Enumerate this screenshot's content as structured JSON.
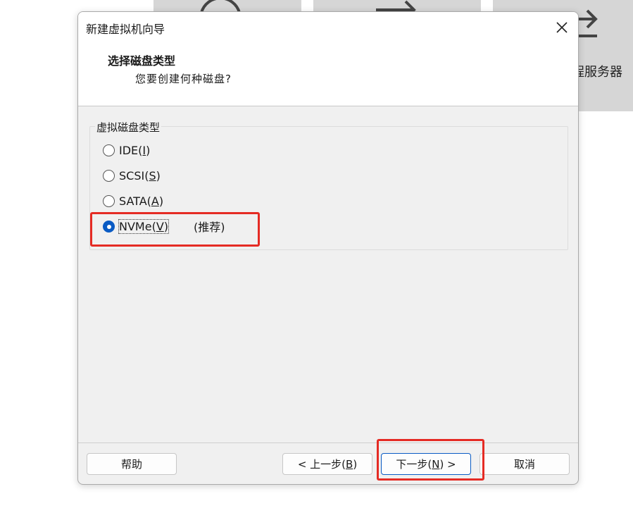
{
  "background": {
    "partial_label": "程服务器"
  },
  "dialog": {
    "title": "新建虚拟机向导",
    "header_title": "选择磁盘类型",
    "header_subtitle": "您要创建何种磁盘?",
    "group_label": "虚拟磁盘类型",
    "options": [
      {
        "label": "IDE(",
        "mnemonic": "I",
        "suffix": ")",
        "checked": false
      },
      {
        "label": "SCSI(",
        "mnemonic": "S",
        "suffix": ")",
        "checked": false
      },
      {
        "label": "SATA(",
        "mnemonic": "A",
        "suffix": ")",
        "checked": false
      },
      {
        "label": "NVMe(",
        "mnemonic": "V",
        "suffix": ")",
        "checked": true,
        "note": "(推荐)"
      }
    ],
    "buttons": {
      "help": "帮助",
      "back_prefix": "< 上一步(",
      "back_mnemonic": "B",
      "back_suffix": ")",
      "next_prefix": "下一步(",
      "next_mnemonic": "N",
      "next_suffix": ") >",
      "cancel": "取消"
    }
  },
  "colors": {
    "accent": "#0a5bc4",
    "highlight": "#e52b24"
  },
  "icons": [
    "close-icon",
    "radio-icon"
  ]
}
